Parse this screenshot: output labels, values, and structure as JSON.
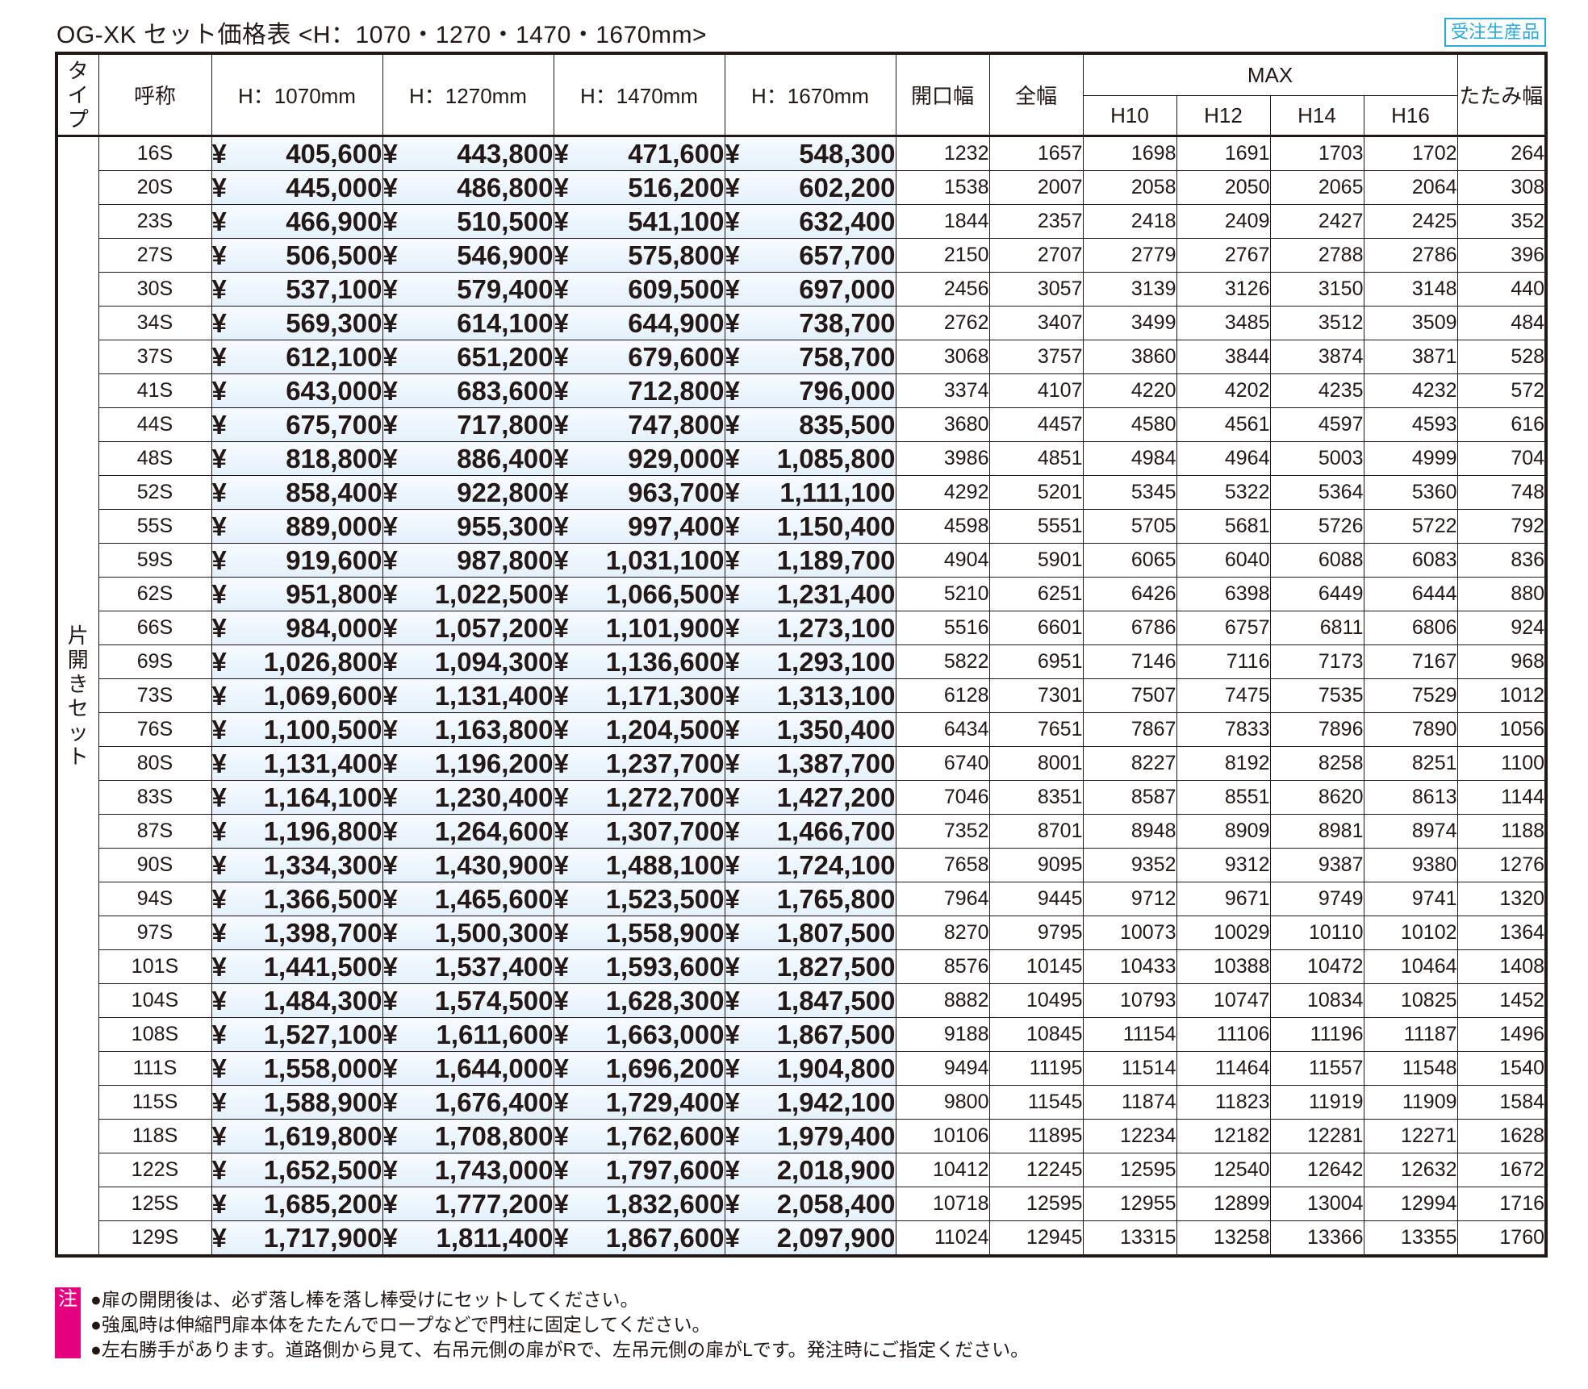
{
  "title": "OG-XK セット価格表 <H：1070・1270・1470・1670mm>",
  "badge": "受注生産品",
  "header": {
    "type": "タイプ",
    "name": "呼称",
    "h1070": "H：1070mm",
    "h1270": "H：1270mm",
    "h1470": "H：1470mm",
    "h1670": "H：1670mm",
    "opening": "開口幅",
    "total": "全幅",
    "max": "MAX",
    "h10": "H10",
    "h12": "H12",
    "h14": "H14",
    "h16": "H16",
    "fold": "たたみ幅"
  },
  "type_label": "片開きセット",
  "currency": "¥",
  "rows": [
    {
      "name": "16S",
      "p": [
        "405,600",
        "443,800",
        "471,600",
        "548,300"
      ],
      "open": "1232",
      "total": "1657",
      "max": [
        "1698",
        "1691",
        "1703",
        "1702"
      ],
      "fold": "264"
    },
    {
      "name": "20S",
      "p": [
        "445,000",
        "486,800",
        "516,200",
        "602,200"
      ],
      "open": "1538",
      "total": "2007",
      "max": [
        "2058",
        "2050",
        "2065",
        "2064"
      ],
      "fold": "308"
    },
    {
      "name": "23S",
      "p": [
        "466,900",
        "510,500",
        "541,100",
        "632,400"
      ],
      "open": "1844",
      "total": "2357",
      "max": [
        "2418",
        "2409",
        "2427",
        "2425"
      ],
      "fold": "352"
    },
    {
      "name": "27S",
      "p": [
        "506,500",
        "546,900",
        "575,800",
        "657,700"
      ],
      "open": "2150",
      "total": "2707",
      "max": [
        "2779",
        "2767",
        "2788",
        "2786"
      ],
      "fold": "396"
    },
    {
      "name": "30S",
      "p": [
        "537,100",
        "579,400",
        "609,500",
        "697,000"
      ],
      "open": "2456",
      "total": "3057",
      "max": [
        "3139",
        "3126",
        "3150",
        "3148"
      ],
      "fold": "440"
    },
    {
      "name": "34S",
      "p": [
        "569,300",
        "614,100",
        "644,900",
        "738,700"
      ],
      "open": "2762",
      "total": "3407",
      "max": [
        "3499",
        "3485",
        "3512",
        "3509"
      ],
      "fold": "484"
    },
    {
      "name": "37S",
      "p": [
        "612,100",
        "651,200",
        "679,600",
        "758,700"
      ],
      "open": "3068",
      "total": "3757",
      "max": [
        "3860",
        "3844",
        "3874",
        "3871"
      ],
      "fold": "528"
    },
    {
      "name": "41S",
      "p": [
        "643,000",
        "683,600",
        "712,800",
        "796,000"
      ],
      "open": "3374",
      "total": "4107",
      "max": [
        "4220",
        "4202",
        "4235",
        "4232"
      ],
      "fold": "572"
    },
    {
      "name": "44S",
      "p": [
        "675,700",
        "717,800",
        "747,800",
        "835,500"
      ],
      "open": "3680",
      "total": "4457",
      "max": [
        "4580",
        "4561",
        "4597",
        "4593"
      ],
      "fold": "616"
    },
    {
      "name": "48S",
      "p": [
        "818,800",
        "886,400",
        "929,000",
        "1,085,800"
      ],
      "open": "3986",
      "total": "4851",
      "max": [
        "4984",
        "4964",
        "5003",
        "4999"
      ],
      "fold": "704"
    },
    {
      "name": "52S",
      "p": [
        "858,400",
        "922,800",
        "963,700",
        "1,111,100"
      ],
      "open": "4292",
      "total": "5201",
      "max": [
        "5345",
        "5322",
        "5364",
        "5360"
      ],
      "fold": "748"
    },
    {
      "name": "55S",
      "p": [
        "889,000",
        "955,300",
        "997,400",
        "1,150,400"
      ],
      "open": "4598",
      "total": "5551",
      "max": [
        "5705",
        "5681",
        "5726",
        "5722"
      ],
      "fold": "792"
    },
    {
      "name": "59S",
      "p": [
        "919,600",
        "987,800",
        "1,031,100",
        "1,189,700"
      ],
      "open": "4904",
      "total": "5901",
      "max": [
        "6065",
        "6040",
        "6088",
        "6083"
      ],
      "fold": "836"
    },
    {
      "name": "62S",
      "p": [
        "951,800",
        "1,022,500",
        "1,066,500",
        "1,231,400"
      ],
      "open": "5210",
      "total": "6251",
      "max": [
        "6426",
        "6398",
        "6449",
        "6444"
      ],
      "fold": "880"
    },
    {
      "name": "66S",
      "p": [
        "984,000",
        "1,057,200",
        "1,101,900",
        "1,273,100"
      ],
      "open": "5516",
      "total": "6601",
      "max": [
        "6786",
        "6757",
        "6811",
        "6806"
      ],
      "fold": "924"
    },
    {
      "name": "69S",
      "p": [
        "1,026,800",
        "1,094,300",
        "1,136,600",
        "1,293,100"
      ],
      "open": "5822",
      "total": "6951",
      "max": [
        "7146",
        "7116",
        "7173",
        "7167"
      ],
      "fold": "968"
    },
    {
      "name": "73S",
      "p": [
        "1,069,600",
        "1,131,400",
        "1,171,300",
        "1,313,100"
      ],
      "open": "6128",
      "total": "7301",
      "max": [
        "7507",
        "7475",
        "7535",
        "7529"
      ],
      "fold": "1012"
    },
    {
      "name": "76S",
      "p": [
        "1,100,500",
        "1,163,800",
        "1,204,500",
        "1,350,400"
      ],
      "open": "6434",
      "total": "7651",
      "max": [
        "7867",
        "7833",
        "7896",
        "7890"
      ],
      "fold": "1056"
    },
    {
      "name": "80S",
      "p": [
        "1,131,400",
        "1,196,200",
        "1,237,700",
        "1,387,700"
      ],
      "open": "6740",
      "total": "8001",
      "max": [
        "8227",
        "8192",
        "8258",
        "8251"
      ],
      "fold": "1100"
    },
    {
      "name": "83S",
      "p": [
        "1,164,100",
        "1,230,400",
        "1,272,700",
        "1,427,200"
      ],
      "open": "7046",
      "total": "8351",
      "max": [
        "8587",
        "8551",
        "8620",
        "8613"
      ],
      "fold": "1144"
    },
    {
      "name": "87S",
      "p": [
        "1,196,800",
        "1,264,600",
        "1,307,700",
        "1,466,700"
      ],
      "open": "7352",
      "total": "8701",
      "max": [
        "8948",
        "8909",
        "8981",
        "8974"
      ],
      "fold": "1188"
    },
    {
      "name": "90S",
      "p": [
        "1,334,300",
        "1,430,900",
        "1,488,100",
        "1,724,100"
      ],
      "open": "7658",
      "total": "9095",
      "max": [
        "9352",
        "9312",
        "9387",
        "9380"
      ],
      "fold": "1276"
    },
    {
      "name": "94S",
      "p": [
        "1,366,500",
        "1,465,600",
        "1,523,500",
        "1,765,800"
      ],
      "open": "7964",
      "total": "9445",
      "max": [
        "9712",
        "9671",
        "9749",
        "9741"
      ],
      "fold": "1320"
    },
    {
      "name": "97S",
      "p": [
        "1,398,700",
        "1,500,300",
        "1,558,900",
        "1,807,500"
      ],
      "open": "8270",
      "total": "9795",
      "max": [
        "10073",
        "10029",
        "10110",
        "10102"
      ],
      "fold": "1364"
    },
    {
      "name": "101S",
      "p": [
        "1,441,500",
        "1,537,400",
        "1,593,600",
        "1,827,500"
      ],
      "open": "8576",
      "total": "10145",
      "max": [
        "10433",
        "10388",
        "10472",
        "10464"
      ],
      "fold": "1408"
    },
    {
      "name": "104S",
      "p": [
        "1,484,300",
        "1,574,500",
        "1,628,300",
        "1,847,500"
      ],
      "open": "8882",
      "total": "10495",
      "max": [
        "10793",
        "10747",
        "10834",
        "10825"
      ],
      "fold": "1452"
    },
    {
      "name": "108S",
      "p": [
        "1,527,100",
        "1,611,600",
        "1,663,000",
        "1,867,500"
      ],
      "open": "9188",
      "total": "10845",
      "max": [
        "11154",
        "11106",
        "11196",
        "11187"
      ],
      "fold": "1496"
    },
    {
      "name": "111S",
      "p": [
        "1,558,000",
        "1,644,000",
        "1,696,200",
        "1,904,800"
      ],
      "open": "9494",
      "total": "11195",
      "max": [
        "11514",
        "11464",
        "11557",
        "11548"
      ],
      "fold": "1540"
    },
    {
      "name": "115S",
      "p": [
        "1,588,900",
        "1,676,400",
        "1,729,400",
        "1,942,100"
      ],
      "open": "9800",
      "total": "11545",
      "max": [
        "11874",
        "11823",
        "11919",
        "11909"
      ],
      "fold": "1584"
    },
    {
      "name": "118S",
      "p": [
        "1,619,800",
        "1,708,800",
        "1,762,600",
        "1,979,400"
      ],
      "open": "10106",
      "total": "11895",
      "max": [
        "12234",
        "12182",
        "12281",
        "12271"
      ],
      "fold": "1628"
    },
    {
      "name": "122S",
      "p": [
        "1,652,500",
        "1,743,000",
        "1,797,600",
        "2,018,900"
      ],
      "open": "10412",
      "total": "12245",
      "max": [
        "12595",
        "12540",
        "12642",
        "12632"
      ],
      "fold": "1672"
    },
    {
      "name": "125S",
      "p": [
        "1,685,200",
        "1,777,200",
        "1,832,600",
        "2,058,400"
      ],
      "open": "10718",
      "total": "12595",
      "max": [
        "12955",
        "12899",
        "13004",
        "12994"
      ],
      "fold": "1716"
    },
    {
      "name": "129S",
      "p": [
        "1,717,900",
        "1,811,400",
        "1,867,600",
        "2,097,900"
      ],
      "open": "11024",
      "total": "12945",
      "max": [
        "13315",
        "13258",
        "13366",
        "13355"
      ],
      "fold": "1760"
    }
  ],
  "notes": {
    "mark": "注",
    "items": [
      "●扉の開閉後は、必ず落し棒を落し棒受けにセットしてください。",
      "●強風時は伸縮門扉本体をたたんでロープなどで門柱に固定してください。",
      "●左右勝手があります。道路側から見て、右吊元側の扉がRで、左吊元側の扉がLです。発注時にご指定ください。"
    ]
  },
  "colors": {
    "accent": "#2aa8d6",
    "note_mark": "#e4007f",
    "price_bg": "#e3f0fb"
  }
}
